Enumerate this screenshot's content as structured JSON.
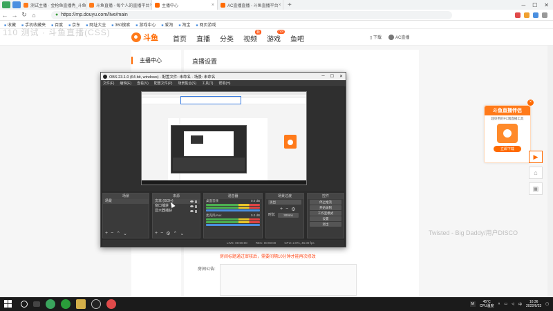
{
  "browser": {
    "tabs": [
      {
        "label": "测试主播 · 金枪鱼直播秀_斗鱼直播",
        "color": "#ff7a1a",
        "active": false
      },
      {
        "label": "斗鱼直播 - 每个人的直播平台",
        "color": "#ff7a1a",
        "active": false
      },
      {
        "label": "主播中心",
        "color": "#ff6a00",
        "active": true
      },
      {
        "label": "AC直播直播 - 斗鱼直播平台",
        "color": "#ff6a00",
        "active": false
      }
    ],
    "new_tab": "+",
    "url": "https://mp.douyu.com/live/main",
    "bookmarks": [
      "收藏",
      "手机收藏夹",
      "百度",
      "京东",
      "网址大全",
      "360搜索",
      "游戏中心",
      "爱淘",
      "淘宝",
      "网页游戏"
    ]
  },
  "site": {
    "logo_text": "斗鱼",
    "nav": [
      {
        "label": "首页",
        "badge": ""
      },
      {
        "label": "直播",
        "badge": ""
      },
      {
        "label": "分类",
        "badge": ""
      },
      {
        "label": "视频",
        "badge": "新"
      },
      {
        "label": "游戏",
        "badge": "hot"
      },
      {
        "label": "鱼吧",
        "badge": ""
      }
    ],
    "download": "下载",
    "username": "AC直播",
    "ghost": "110 测试 · 斗鱼直播(CSS)"
  },
  "page": {
    "left_title": "主播中心",
    "main_title": "直播设置",
    "warn_text": "房间标题通过审核后，需要间隔10分钟才能再次修改",
    "notice_label": "房间公告:"
  },
  "promo": {
    "title": "斗鱼直播伴侣",
    "subtitle": "超好用的PC端直播工具",
    "button": "立即下载",
    "close": "×"
  },
  "watermark": "Twisted - Big Daddy/用户DISCO",
  "obs": {
    "title": "OBS 23.1.0 (64-bit, windows) - 配置文件: 未命名 - 场景: 未命名",
    "menu": [
      "文件(F)",
      "编辑(E)",
      "查看(V)",
      "配置文件(P)",
      "场景集合(S)",
      "工具(T)",
      "帮助(H)"
    ],
    "docks": {
      "scenes": {
        "title": "场景",
        "items": [
          "场景"
        ]
      },
      "sources": {
        "title": "来源",
        "items": [
          "文本 (GDI+)",
          "窗口捕获",
          "显示器捕获"
        ]
      },
      "mixer": {
        "title": "混音器",
        "tracks": [
          {
            "name": "桌面音频",
            "db": "0.0 dB"
          },
          {
            "name": "麦克风/Aux",
            "db": "0.0 dB"
          }
        ]
      },
      "transitions": {
        "title": "场景过渡",
        "mode": "淡出",
        "duration_label": "时长",
        "duration": "300ms"
      },
      "controls": {
        "title": "控件",
        "buttons": [
          "停止推流",
          "开始录制",
          "工作室模式",
          "设置",
          "退出"
        ]
      }
    },
    "status": [
      "LIVE: 00:00:00",
      "REC: 00:00:00",
      "CPU: 2.0%, 45.00 fps"
    ]
  },
  "taskbar": {
    "weather_temp": "45°C",
    "weather_desc": "CPU温度",
    "time": "10:36",
    "date": "2022/6/23",
    "input_method": "M"
  }
}
